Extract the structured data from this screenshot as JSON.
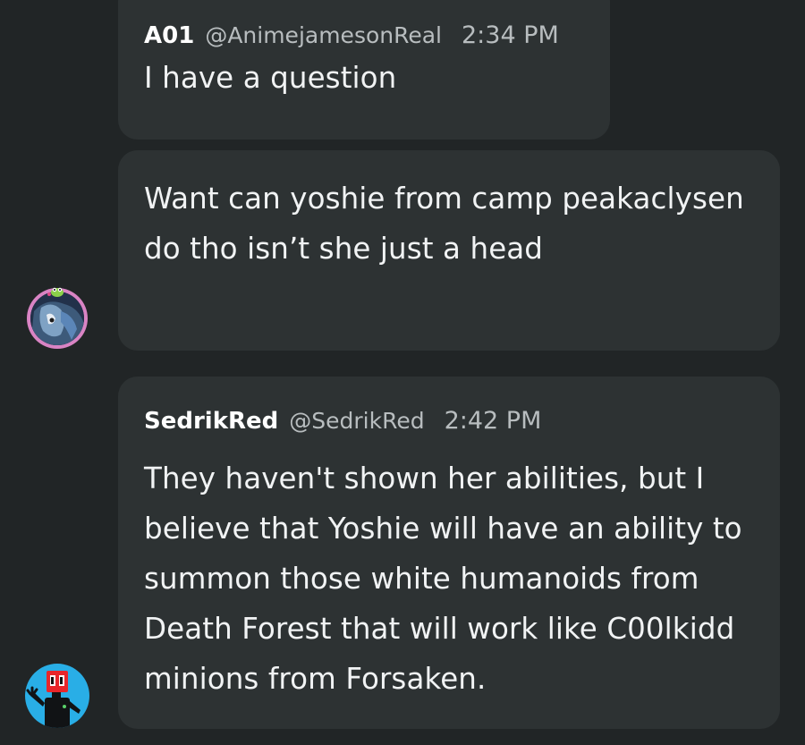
{
  "messages": [
    {
      "author": "A01",
      "handle": "@AnimejamesonReal",
      "time": "2:34 PM",
      "text": "I have a question"
    },
    {
      "text": "Want can yoshie from camp peakaclysen do tho isn’t she just a head"
    },
    {
      "author": "SedrikRed",
      "handle": "@SedrikRed",
      "time": "2:42 PM",
      "text": "They haven't shown her abilities, but I believe that Yoshie will have an ability to summon those white humanoids from Death Forest that will work like C00lkidd minions from Forsaken."
    }
  ],
  "colors": {
    "background": "#212526",
    "bubble": "#2d3233",
    "meta_text": "#b8bdbf",
    "avatar1_ring": "#d984c4",
    "avatar2_bg": "#29aee6",
    "avatar2_badge": "#e8262a"
  },
  "avatars": [
    {
      "icon": "anime-character-avatar-icon"
    },
    {
      "icon": "red-robot-character-avatar-icon"
    }
  ]
}
